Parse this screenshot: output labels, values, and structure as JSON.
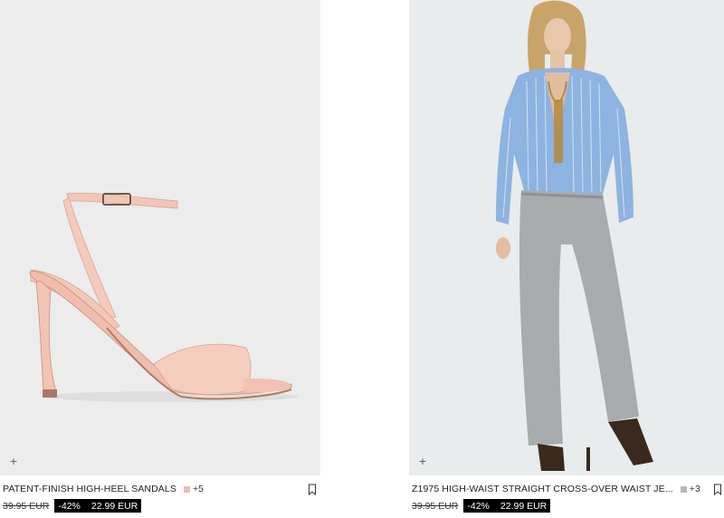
{
  "products": [
    {
      "title": "PATENT-FINISH HIGH-HEEL SANDALS",
      "swatch_color": "#e8bfae",
      "more_colors": "+5",
      "old_price": "39.95 EUR",
      "discount": "-42%",
      "new_price": "22.99 EUR",
      "plus_icon": "+",
      "image": "pink-heel-sandal-image"
    },
    {
      "title": "Z1975 HIGH-WAIST STRAIGHT CROSS-OVER WAIST JE...",
      "swatch_color": "#b8b8b8",
      "more_colors": "+3",
      "old_price": "39.95 EUR",
      "discount": "-42%",
      "new_price": "22.99 EUR",
      "plus_icon": "+",
      "image": "model-striped-shirt-grey-jeans-image"
    }
  ],
  "colors": {
    "discount_bg": "#000000",
    "discount_text": "#ffffff"
  }
}
